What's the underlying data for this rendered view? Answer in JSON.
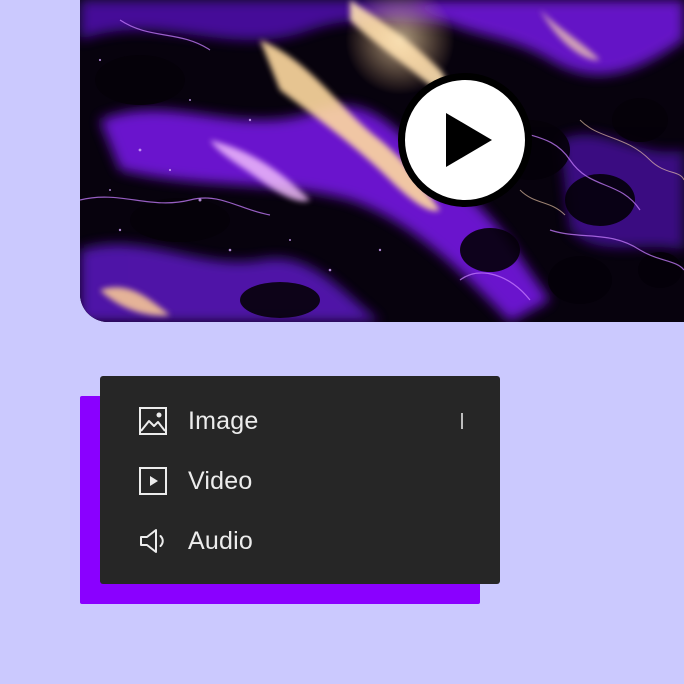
{
  "video": {
    "accent_color": "#8a00ff",
    "highlight_color": "#ffd9a0"
  },
  "menu": {
    "items": [
      {
        "label": "Image",
        "icon": "image-icon"
      },
      {
        "label": "Video",
        "icon": "video-icon"
      },
      {
        "label": "Audio",
        "icon": "audio-icon"
      }
    ]
  }
}
